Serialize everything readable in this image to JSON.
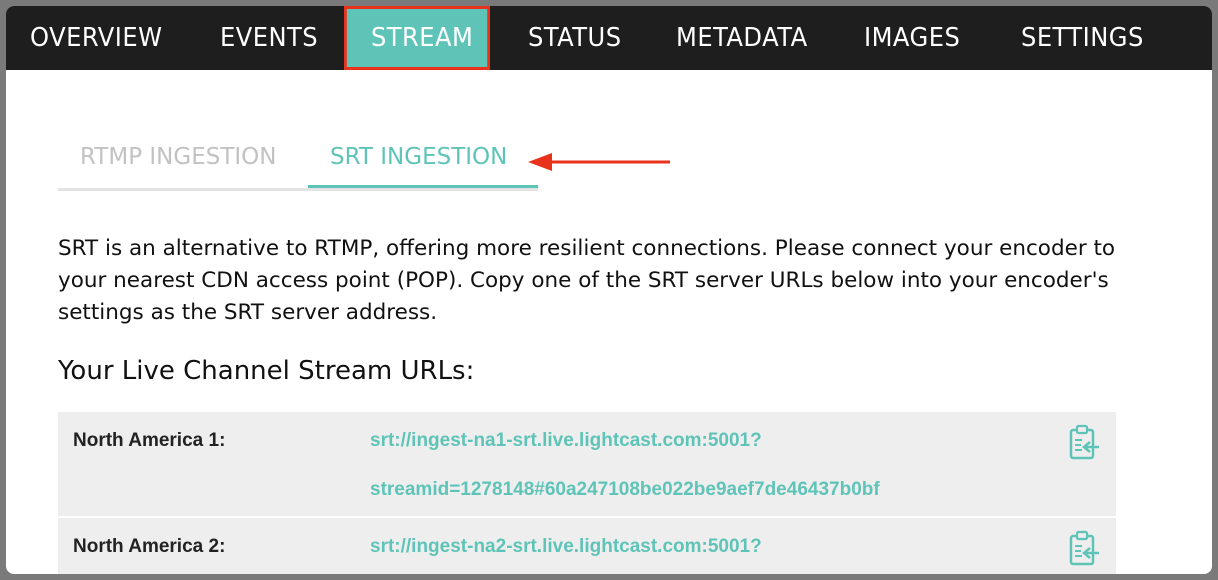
{
  "nav": {
    "tabs": [
      "OVERVIEW",
      "EVENTS",
      "STREAM",
      "STATUS",
      "METADATA",
      "IMAGES",
      "SETTINGS"
    ],
    "active": "STREAM"
  },
  "subtabs": {
    "rtmp": "RTMP INGESTION",
    "srt": "SRT INGESTION",
    "active": "SRT INGESTION"
  },
  "description": "SRT is an alternative to RTMP, offering more resilient connections. Please connect your encoder to your nearest CDN access point (POP). Copy one of the SRT server URLs below into your encoder's settings as the SRT server address.",
  "heading": "Your Live Channel Stream URLs:",
  "rows": [
    {
      "label": "North America 1:",
      "url_line1": "srt://ingest-na1-srt.live.lightcast.com:5001?",
      "url_line2": "streamid=1278148#60a247108be022be9aef7de46437b0bf"
    },
    {
      "label": "North America 2:",
      "url_line1": "srt://ingest-na2-srt.live.lightcast.com:5001?"
    }
  ],
  "colors": {
    "accent": "#5fc4b8",
    "highlight": "#e8321c",
    "nav_bg": "#1e1e1e"
  },
  "icons": [
    "copy-to-clipboard-icon",
    "red-arrow-annotation"
  ]
}
